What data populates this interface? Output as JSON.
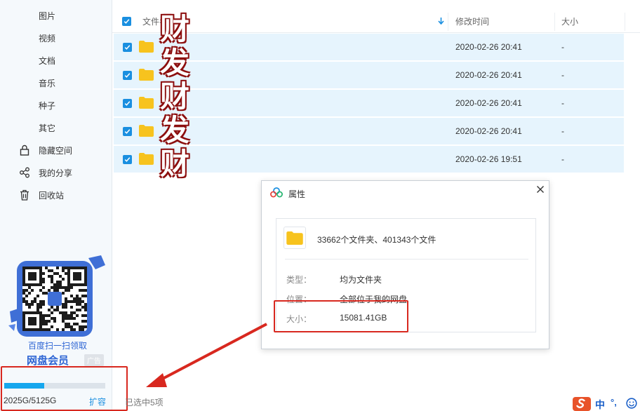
{
  "sidebar": {
    "items": [
      {
        "label": "图片",
        "icon": "image-icon"
      },
      {
        "label": "视频",
        "icon": "video-icon"
      },
      {
        "label": "文档",
        "icon": "document-icon"
      },
      {
        "label": "音乐",
        "icon": "music-icon"
      },
      {
        "label": "种子",
        "icon": "torrent-icon"
      },
      {
        "label": "其它",
        "icon": "other-icon"
      },
      {
        "label": "隐藏空间",
        "icon": "lock-icon"
      },
      {
        "label": "我的分享",
        "icon": "share-icon"
      },
      {
        "label": "回收站",
        "icon": "trash-icon"
      }
    ],
    "ad": {
      "line1": "百度扫一扫领取",
      "line2": "网盘会员",
      "badge": "广告"
    },
    "storage": {
      "used_text": "2025G/5125G",
      "used_fraction": 0.395,
      "expand_label": "扩容"
    }
  },
  "file_list": {
    "columns": {
      "name": "文件名",
      "modified": "修改时间",
      "size": "大小"
    },
    "rows": [
      {
        "modified": "2020-02-26 20:41",
        "size": "-"
      },
      {
        "modified": "2020-02-26 20:41",
        "size": "-"
      },
      {
        "modified": "2020-02-26 20:41",
        "size": "-"
      },
      {
        "modified": "2020-02-26 20:41",
        "size": "-"
      },
      {
        "modified": "2020-02-26 19:51",
        "size": "-"
      }
    ],
    "overlay_text": [
      "财",
      "发",
      "财",
      "发",
      "财"
    ]
  },
  "dialog": {
    "title": "属性",
    "summary": "33662个文件夹、401343个文件",
    "properties": [
      {
        "label": "类型：",
        "value": "均为文件夹"
      },
      {
        "label": "位置：",
        "value": "全部位于我的网盘"
      },
      {
        "label": "大小：",
        "value": "15081.41GB"
      }
    ]
  },
  "status": {
    "selection": "已选中5项"
  },
  "ime": {
    "mode": "中",
    "punct": "°,"
  },
  "colors": {
    "accent": "#1a8fe0",
    "highlight": "#d8281f",
    "row_selected": "#e6f4fd",
    "folder": "#f7c31e"
  }
}
